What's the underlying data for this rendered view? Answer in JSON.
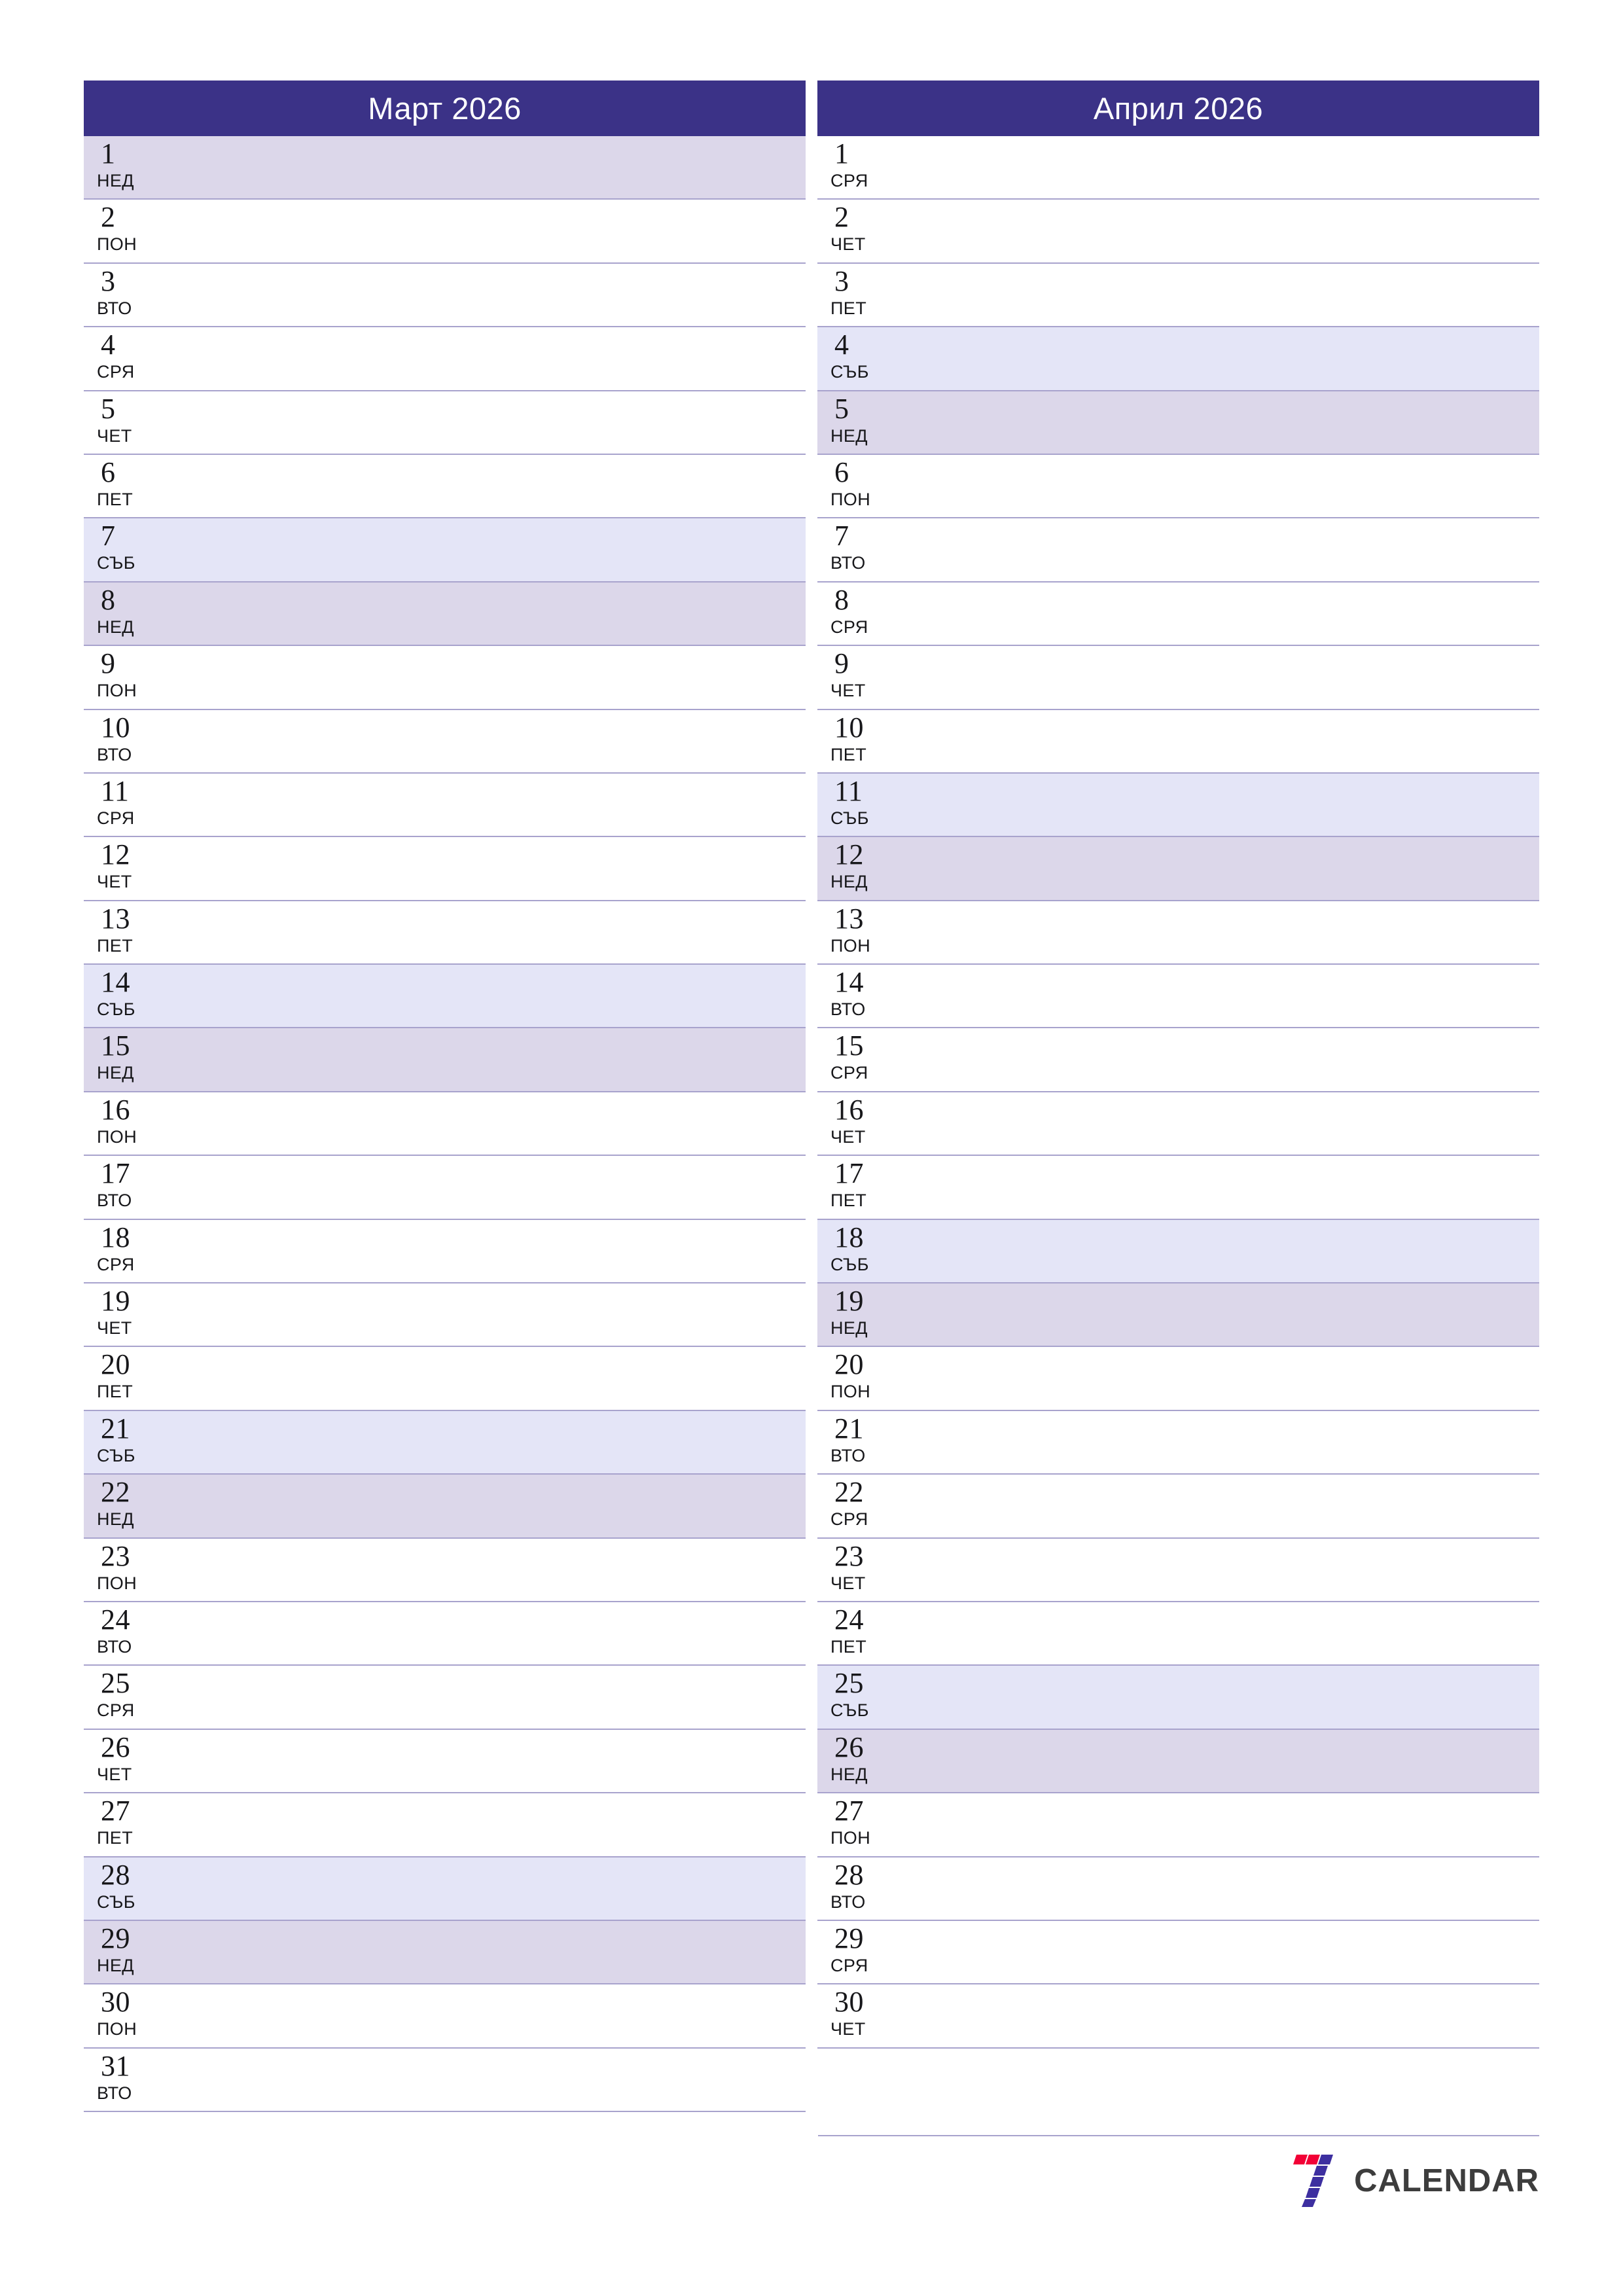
{
  "document": {
    "type": "monthly-planner",
    "orientation": "portrait",
    "language": "bg"
  },
  "theme": {
    "header_bg": "#3b3287",
    "header_text": "#ffffff",
    "saturday_bg": "#e4e5f7",
    "sunday_bg": "#dcd7ea",
    "row_border": "#a8a3cd",
    "text": "#17171a",
    "logo_red": "#f20036",
    "logo_purple": "#3d2fa0",
    "logo_word": "#3d3d3d"
  },
  "months": [
    {
      "title": "Март 2026",
      "days": [
        {
          "num": "1",
          "abbr": "НЕД",
          "kind": "sun"
        },
        {
          "num": "2",
          "abbr": "ПОН",
          "kind": "weekday"
        },
        {
          "num": "3",
          "abbr": "ВТО",
          "kind": "weekday"
        },
        {
          "num": "4",
          "abbr": "СРЯ",
          "kind": "weekday"
        },
        {
          "num": "5",
          "abbr": "ЧЕТ",
          "kind": "weekday"
        },
        {
          "num": "6",
          "abbr": "ПЕТ",
          "kind": "weekday"
        },
        {
          "num": "7",
          "abbr": "СЪБ",
          "kind": "sat"
        },
        {
          "num": "8",
          "abbr": "НЕД",
          "kind": "sun"
        },
        {
          "num": "9",
          "abbr": "ПОН",
          "kind": "weekday"
        },
        {
          "num": "10",
          "abbr": "ВТО",
          "kind": "weekday"
        },
        {
          "num": "11",
          "abbr": "СРЯ",
          "kind": "weekday"
        },
        {
          "num": "12",
          "abbr": "ЧЕТ",
          "kind": "weekday"
        },
        {
          "num": "13",
          "abbr": "ПЕТ",
          "kind": "weekday"
        },
        {
          "num": "14",
          "abbr": "СЪБ",
          "kind": "sat"
        },
        {
          "num": "15",
          "abbr": "НЕД",
          "kind": "sun"
        },
        {
          "num": "16",
          "abbr": "ПОН",
          "kind": "weekday"
        },
        {
          "num": "17",
          "abbr": "ВТО",
          "kind": "weekday"
        },
        {
          "num": "18",
          "abbr": "СРЯ",
          "kind": "weekday"
        },
        {
          "num": "19",
          "abbr": "ЧЕТ",
          "kind": "weekday"
        },
        {
          "num": "20",
          "abbr": "ПЕТ",
          "kind": "weekday"
        },
        {
          "num": "21",
          "abbr": "СЪБ",
          "kind": "sat"
        },
        {
          "num": "22",
          "abbr": "НЕД",
          "kind": "sun"
        },
        {
          "num": "23",
          "abbr": "ПОН",
          "kind": "weekday"
        },
        {
          "num": "24",
          "abbr": "ВТО",
          "kind": "weekday"
        },
        {
          "num": "25",
          "abbr": "СРЯ",
          "kind": "weekday"
        },
        {
          "num": "26",
          "abbr": "ЧЕТ",
          "kind": "weekday"
        },
        {
          "num": "27",
          "abbr": "ПЕТ",
          "kind": "weekday"
        },
        {
          "num": "28",
          "abbr": "СЪБ",
          "kind": "sat"
        },
        {
          "num": "29",
          "abbr": "НЕД",
          "kind": "sun"
        },
        {
          "num": "30",
          "abbr": "ПОН",
          "kind": "weekday"
        },
        {
          "num": "31",
          "abbr": "ВТО",
          "kind": "weekday"
        }
      ]
    },
    {
      "title": "Април 2026",
      "days": [
        {
          "num": "1",
          "abbr": "СРЯ",
          "kind": "weekday"
        },
        {
          "num": "2",
          "abbr": "ЧЕТ",
          "kind": "weekday"
        },
        {
          "num": "3",
          "abbr": "ПЕТ",
          "kind": "weekday"
        },
        {
          "num": "4",
          "abbr": "СЪБ",
          "kind": "sat"
        },
        {
          "num": "5",
          "abbr": "НЕД",
          "kind": "sun"
        },
        {
          "num": "6",
          "abbr": "ПОН",
          "kind": "weekday"
        },
        {
          "num": "7",
          "abbr": "ВТО",
          "kind": "weekday"
        },
        {
          "num": "8",
          "abbr": "СРЯ",
          "kind": "weekday"
        },
        {
          "num": "9",
          "abbr": "ЧЕТ",
          "kind": "weekday"
        },
        {
          "num": "10",
          "abbr": "ПЕТ",
          "kind": "weekday"
        },
        {
          "num": "11",
          "abbr": "СЪБ",
          "kind": "sat"
        },
        {
          "num": "12",
          "abbr": "НЕД",
          "kind": "sun"
        },
        {
          "num": "13",
          "abbr": "ПОН",
          "kind": "weekday"
        },
        {
          "num": "14",
          "abbr": "ВТО",
          "kind": "weekday"
        },
        {
          "num": "15",
          "abbr": "СРЯ",
          "kind": "weekday"
        },
        {
          "num": "16",
          "abbr": "ЧЕТ",
          "kind": "weekday"
        },
        {
          "num": "17",
          "abbr": "ПЕТ",
          "kind": "weekday"
        },
        {
          "num": "18",
          "abbr": "СЪБ",
          "kind": "sat"
        },
        {
          "num": "19",
          "abbr": "НЕД",
          "kind": "sun"
        },
        {
          "num": "20",
          "abbr": "ПОН",
          "kind": "weekday"
        },
        {
          "num": "21",
          "abbr": "ВТО",
          "kind": "weekday"
        },
        {
          "num": "22",
          "abbr": "СРЯ",
          "kind": "weekday"
        },
        {
          "num": "23",
          "abbr": "ЧЕТ",
          "kind": "weekday"
        },
        {
          "num": "24",
          "abbr": "ПЕТ",
          "kind": "weekday"
        },
        {
          "num": "25",
          "abbr": "СЪБ",
          "kind": "sat"
        },
        {
          "num": "26",
          "abbr": "НЕД",
          "kind": "sun"
        },
        {
          "num": "27",
          "abbr": "ПОН",
          "kind": "weekday"
        },
        {
          "num": "28",
          "abbr": "ВТО",
          "kind": "weekday"
        },
        {
          "num": "29",
          "abbr": "СРЯ",
          "kind": "weekday"
        },
        {
          "num": "30",
          "abbr": "ЧЕТ",
          "kind": "weekday"
        }
      ]
    }
  ],
  "footer": {
    "logo_text": "CALENDAR",
    "logo_mark": "seven-logo-icon"
  }
}
